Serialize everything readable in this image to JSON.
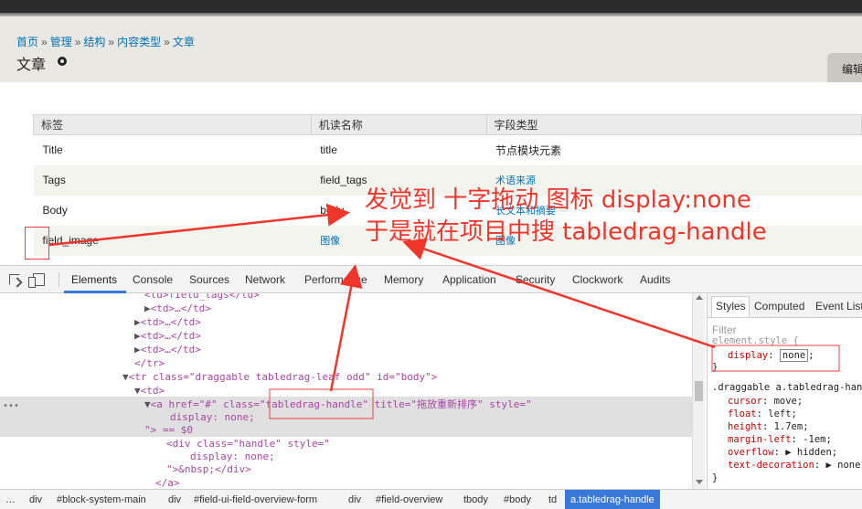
{
  "breadcrumb": {
    "items": [
      "首页",
      "管理",
      "结构",
      "内容类型",
      "文章"
    ],
    "separator": "»"
  },
  "page": {
    "title": "文章",
    "edit_tab": "编辑"
  },
  "fields_table": {
    "headers": [
      "标签",
      "机读名称",
      "字段类型"
    ],
    "rows": [
      {
        "label": "Title",
        "machine_name": "title",
        "type": "节点模块元素"
      },
      {
        "label": "Tags",
        "machine_name": "field_tags",
        "type": "术语来源"
      },
      {
        "label": "Body",
        "machine_name": "body",
        "type": "长文本和摘要"
      },
      {
        "label": "field_image",
        "machine_name": "图像",
        "type": "图像"
      }
    ]
  },
  "annotation": {
    "line1": "发觉到 十字拖动 图标 display:none",
    "line2": "于是就在项目中搜 tabledrag-handle",
    "color": "#f0352b"
  },
  "devtools": {
    "tabs": [
      "Elements",
      "Console",
      "Sources",
      "Network",
      "Performance",
      "Memory",
      "Application",
      "Security",
      "Clockwork",
      "Audits"
    ],
    "active_tab": "Elements",
    "dom_lines": [
      {
        "text": "<td>field_tags</td>"
      },
      {
        "text": "<td>…</td>"
      },
      {
        "text": "<td>…</td>"
      },
      {
        "text": "<td>…</td>"
      },
      {
        "text": "<td>…</td>"
      },
      {
        "text": "</tr>"
      },
      {
        "text": "<tr class=\"draggable tabledrag-leaf odd\" id=\"body\">"
      },
      {
        "text": "<td>"
      },
      {
        "text": "<a href=\"#\" class=\"tabledrag-handle\" title=\"拖放重新排序\" style=\""
      },
      {
        "text": "display: none;"
      },
      {
        "text": "\"> == $0"
      },
      {
        "text": "<div class=\"handle\" style=\""
      },
      {
        "text": "display: none;"
      },
      {
        "text": "\">&nbsp;</div>"
      },
      {
        "text": "</a>"
      }
    ],
    "styles_tabs": [
      "Styles",
      "Computed",
      "Event Listeners"
    ],
    "styles_filter_placeholder": "Filter",
    "element_style": {
      "selector": "element.style {",
      "prop": "display",
      "value": "none"
    },
    "draggable_rule": {
      "selector": ".draggable a.tabledrag-handle",
      "declarations": [
        {
          "prop": "cursor",
          "value": "move;"
        },
        {
          "prop": "float",
          "value": "left;"
        },
        {
          "prop": "height",
          "value": "1.7em;"
        },
        {
          "prop": "margin-left",
          "value": "-1em;"
        },
        {
          "prop": "overflow",
          "value": "▶ hidden;"
        },
        {
          "prop": "text-decoration",
          "value": "▶ none;"
        }
      ]
    },
    "crumbs": [
      "…",
      "div",
      "#block-system-main",
      "div",
      "#field-ui-field-overview-form",
      "div",
      "#field-overview",
      "tbody",
      "#body",
      "td",
      "a.tabledrag-handle"
    ]
  }
}
